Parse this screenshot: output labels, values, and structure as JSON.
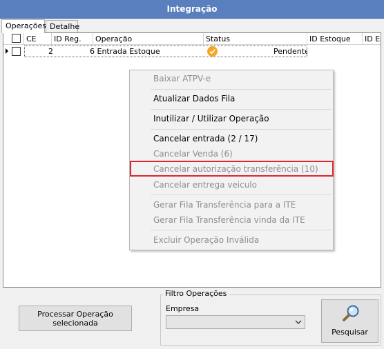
{
  "window": {
    "title": "Integração"
  },
  "tabs": [
    {
      "label": "Operações",
      "active": true
    },
    {
      "label": "Detalhe",
      "active": false
    }
  ],
  "grid": {
    "columns": [
      "CE",
      "ID Reg.",
      "Operação",
      "Status",
      "ID Estoque",
      "ID Es"
    ],
    "rows": [
      {
        "id_reg": "2",
        "operacao": "6 Entrada Estoque",
        "status_icon": "check-circle-icon",
        "status": "Pendente"
      }
    ]
  },
  "context_menu": {
    "items": [
      {
        "label": "Baixar ATPV-e",
        "enabled": false
      },
      {
        "label": "Atualizar Dados Fila",
        "enabled": true
      },
      {
        "label": "Inutilizar / Utilizar Operação",
        "enabled": true
      },
      {
        "label": "Cancelar entrada (2 / 17)",
        "enabled": true
      },
      {
        "label": "Cancelar Venda (6)",
        "enabled": false
      },
      {
        "label": "Cancelar autorização transferência (10)",
        "enabled": false,
        "highlighted": true
      },
      {
        "label": "Cancelar entrega veiculo",
        "enabled": false
      },
      {
        "label": "Gerar Fila Transferência para a ITE",
        "enabled": false
      },
      {
        "label": "Gerar Fila Transferência vinda da ITE",
        "enabled": false
      },
      {
        "label": "Excluir Operação Inválida",
        "enabled": false
      }
    ],
    "highlight_color": "#e0262b"
  },
  "filtro": {
    "legend": "Filtro Operações",
    "empresa_label": "Empresa",
    "empresa_value": ""
  },
  "buttons": {
    "processar": "Processar Operação selecionada",
    "pesquisar": "Pesquisar"
  },
  "colors": {
    "title_bar": "#5a7fbf",
    "status_ok": "#f5a623"
  }
}
